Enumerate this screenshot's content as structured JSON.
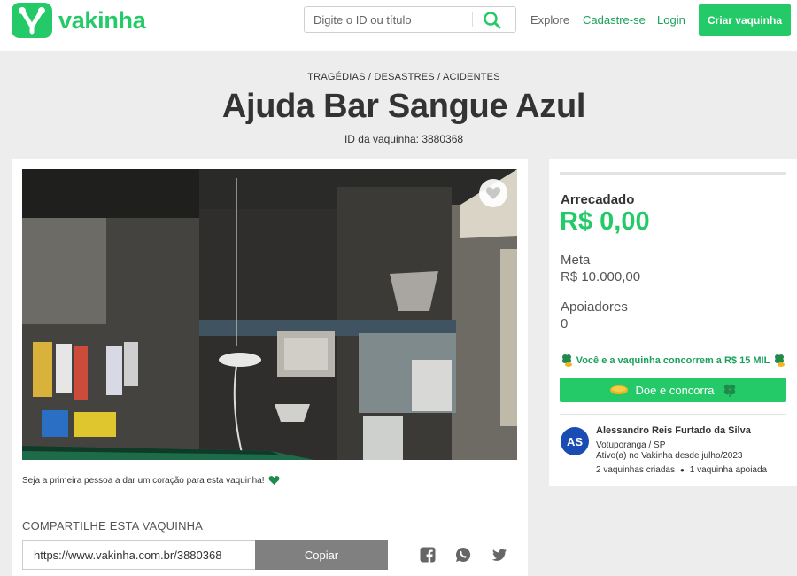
{
  "header": {
    "logo_text": "vakinha",
    "search_placeholder": "Digite o ID ou título",
    "nav": {
      "explore": "Explore",
      "signup": "Cadastre-se",
      "login": "Login"
    },
    "create_button": "Criar vaquinha",
    "brand_color": "#24ca68"
  },
  "campaign": {
    "category": "TRAGÉDIAS / DESASTRES / ACIDENTES",
    "title": "Ajuda Bar Sangue Azul",
    "id_text": "ID da vaquinha: 3880368",
    "first_heart_text": "Seja a primeira pessoa a dar um coração para esta vaquinha!"
  },
  "share": {
    "title": "COMPARTILHE ESTA VAQUINHA",
    "url": "https://www.vakinha.com.br/3880368",
    "copy_label": "Copiar",
    "networks": [
      "facebook-icon",
      "whatsapp-icon",
      "twitter-icon"
    ]
  },
  "stats": {
    "progress_fraction": 0,
    "raised_label": "Arrecadado",
    "raised_value": "R$ 0,00",
    "goal_label": "Meta",
    "goal_value": "R$ 10.000,00",
    "backers_label": "Apoiadores",
    "backers_value": "0",
    "promo_text": "Você e a vaquinha concorrem a R$ 15 MIL",
    "donate_label": "Doe e concorra"
  },
  "owner": {
    "initials": "AS",
    "name": "Alessandro Reis Furtado da Silva",
    "location": "Votuporanga / SP",
    "since": "Ativo(a) no Vakinha desde julho/2023",
    "created": "2 vaquinhas criadas",
    "supported": "1 vaquinha apoiada"
  }
}
